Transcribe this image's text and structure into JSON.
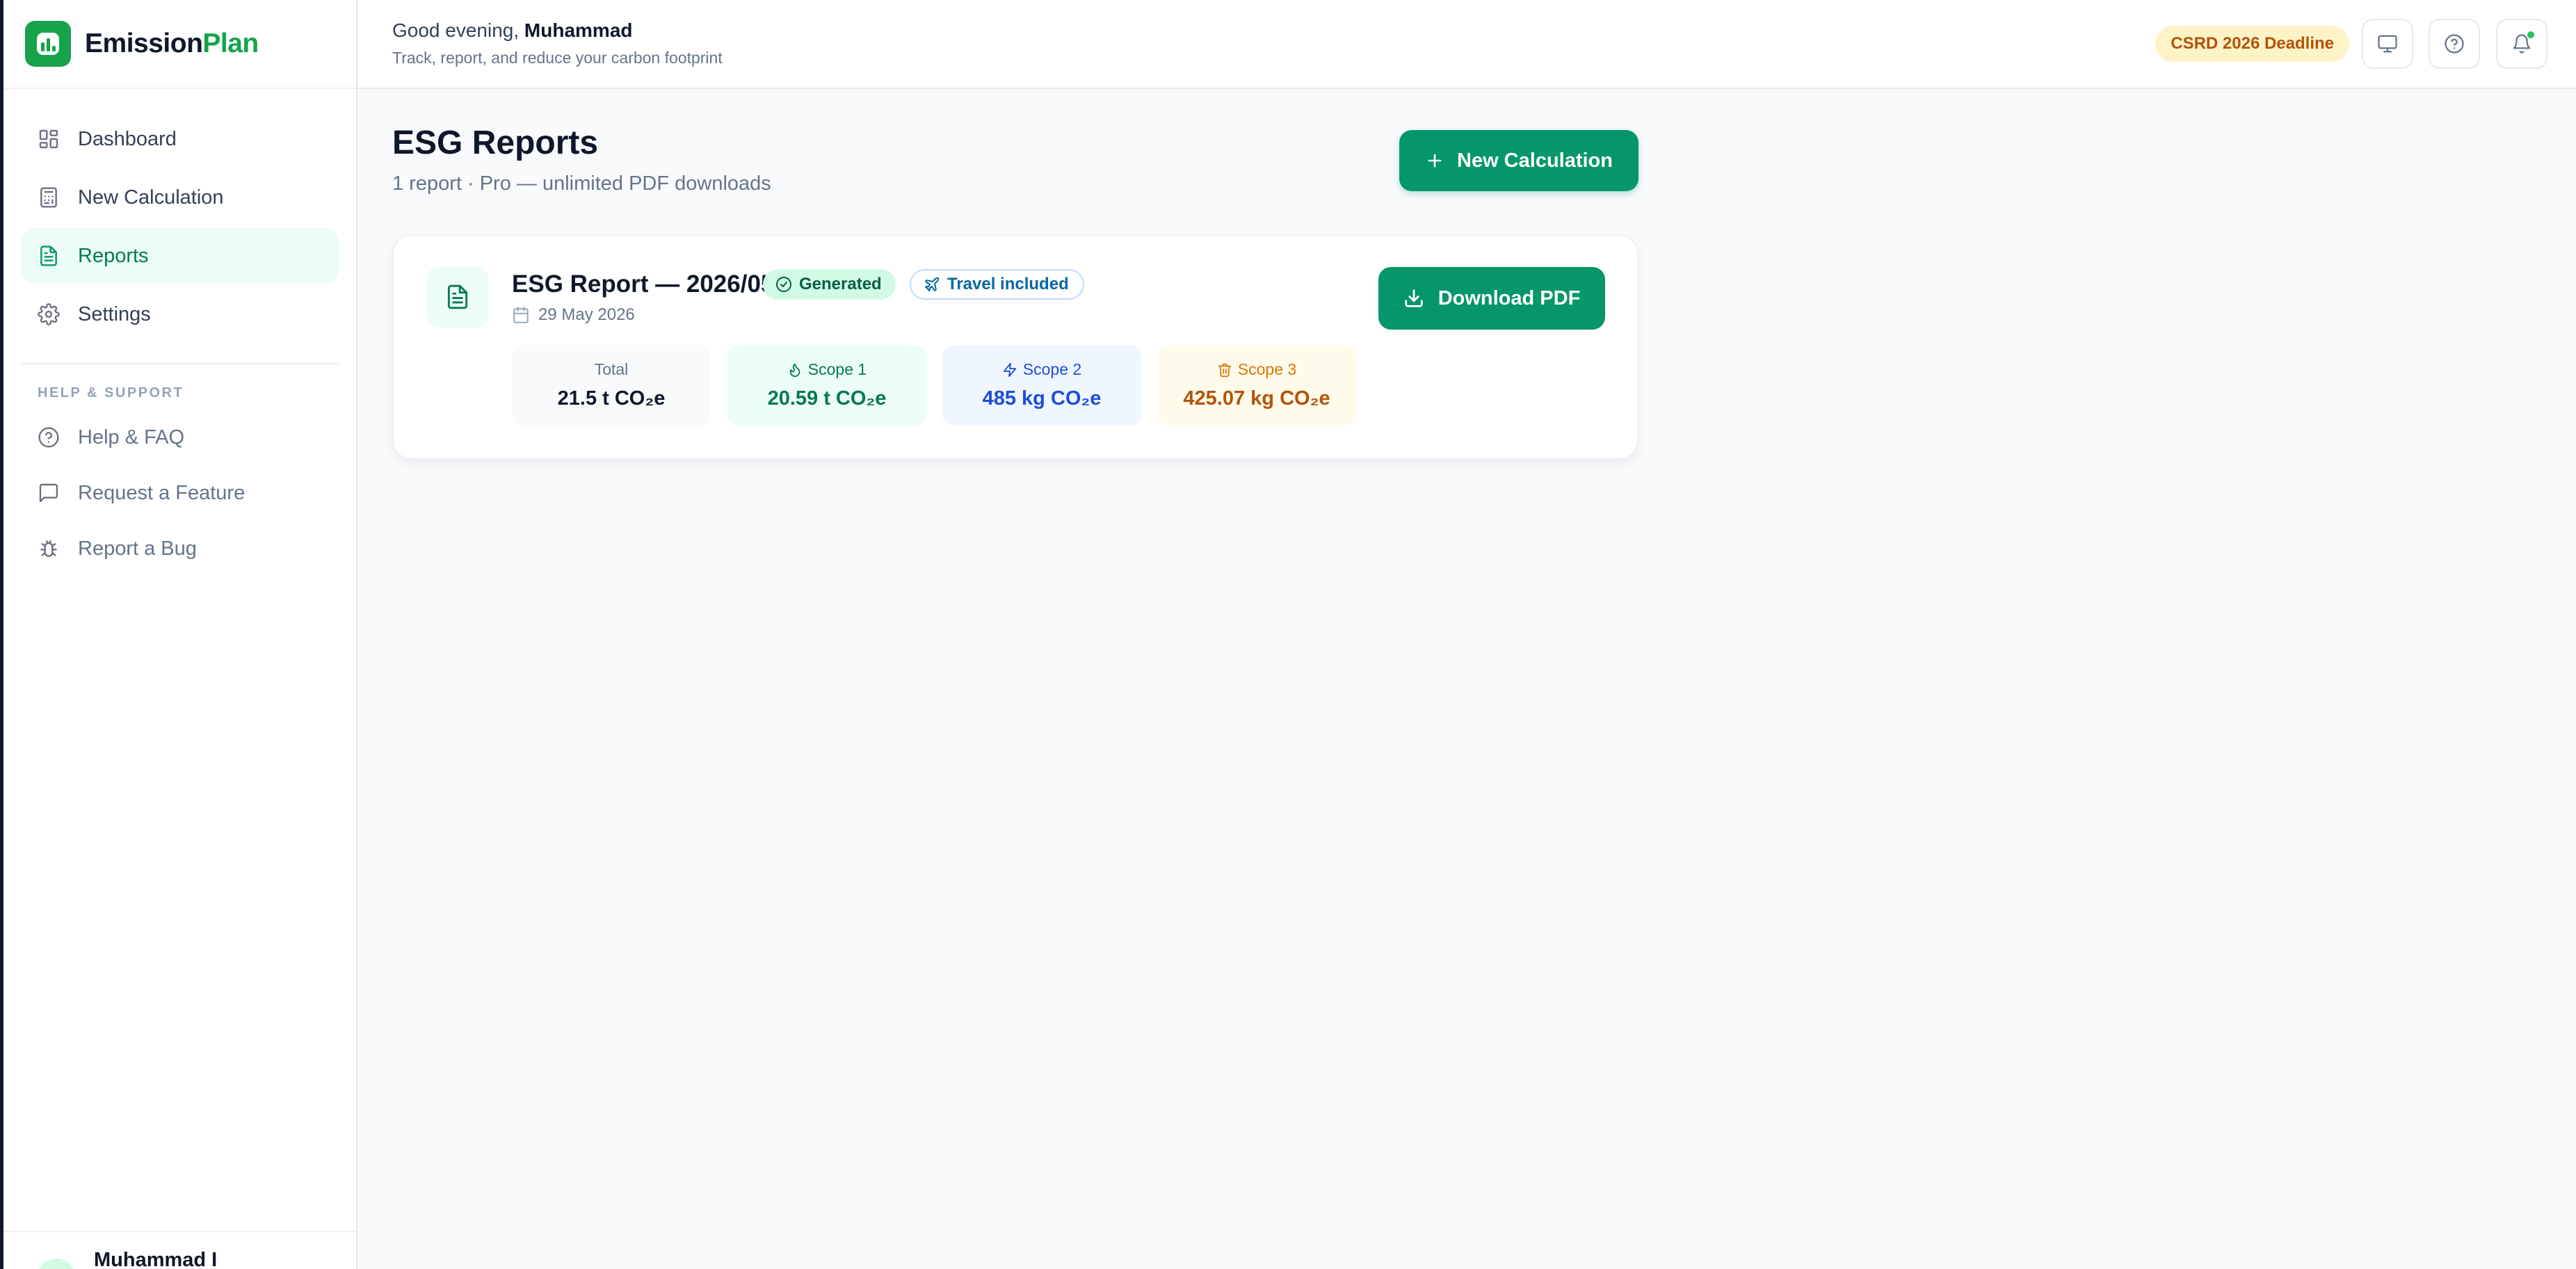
{
  "brand": {
    "name_part1": "Emission",
    "name_part2": "Plan"
  },
  "sidebar": {
    "nav": [
      {
        "label": "Dashboard",
        "icon": "dashboard-icon"
      },
      {
        "label": "New Calculation",
        "icon": "calculator-icon"
      },
      {
        "label": "Reports",
        "icon": "file-text-icon",
        "active": true
      },
      {
        "label": "Settings",
        "icon": "gear-icon"
      }
    ],
    "support_heading": "HELP & SUPPORT",
    "support": [
      {
        "label": "Help & FAQ",
        "icon": "help-circle-icon"
      },
      {
        "label": "Request a Feature",
        "icon": "message-square-icon"
      },
      {
        "label": "Report a Bug",
        "icon": "bug-icon"
      }
    ],
    "user_name": "Muhammad I"
  },
  "header": {
    "greeting": "Good evening,",
    "user": "Muhammad",
    "subtitle": "Track, report, and reduce your carbon footprint",
    "deadline_badge": "CSRD 2026 Deadline"
  },
  "main": {
    "title": "ESG Reports",
    "subtitle": "1 report · Pro — unlimited PDF downloads",
    "new_calc_label": "New Calculation",
    "report": {
      "title": "ESG Report — 2026/05",
      "status": "Generated",
      "travel_badge": "Travel included",
      "date": "29 May 2026",
      "download_label": "Download PDF",
      "tiles": {
        "total": {
          "label": "Total",
          "value": "21.5 t CO₂e"
        },
        "scope1": {
          "label": "Scope 1",
          "value": "20.59 t CO₂e"
        },
        "scope2": {
          "label": "Scope 2",
          "value": "485 kg CO₂e"
        },
        "scope3": {
          "label": "Scope 3",
          "value": "425.07 kg CO₂e"
        }
      }
    }
  },
  "colors": {
    "brand": "#16a34a",
    "primary_button": "#059669",
    "scope1": "#047857",
    "scope2": "#1d4ed8",
    "scope3": "#b45309"
  }
}
